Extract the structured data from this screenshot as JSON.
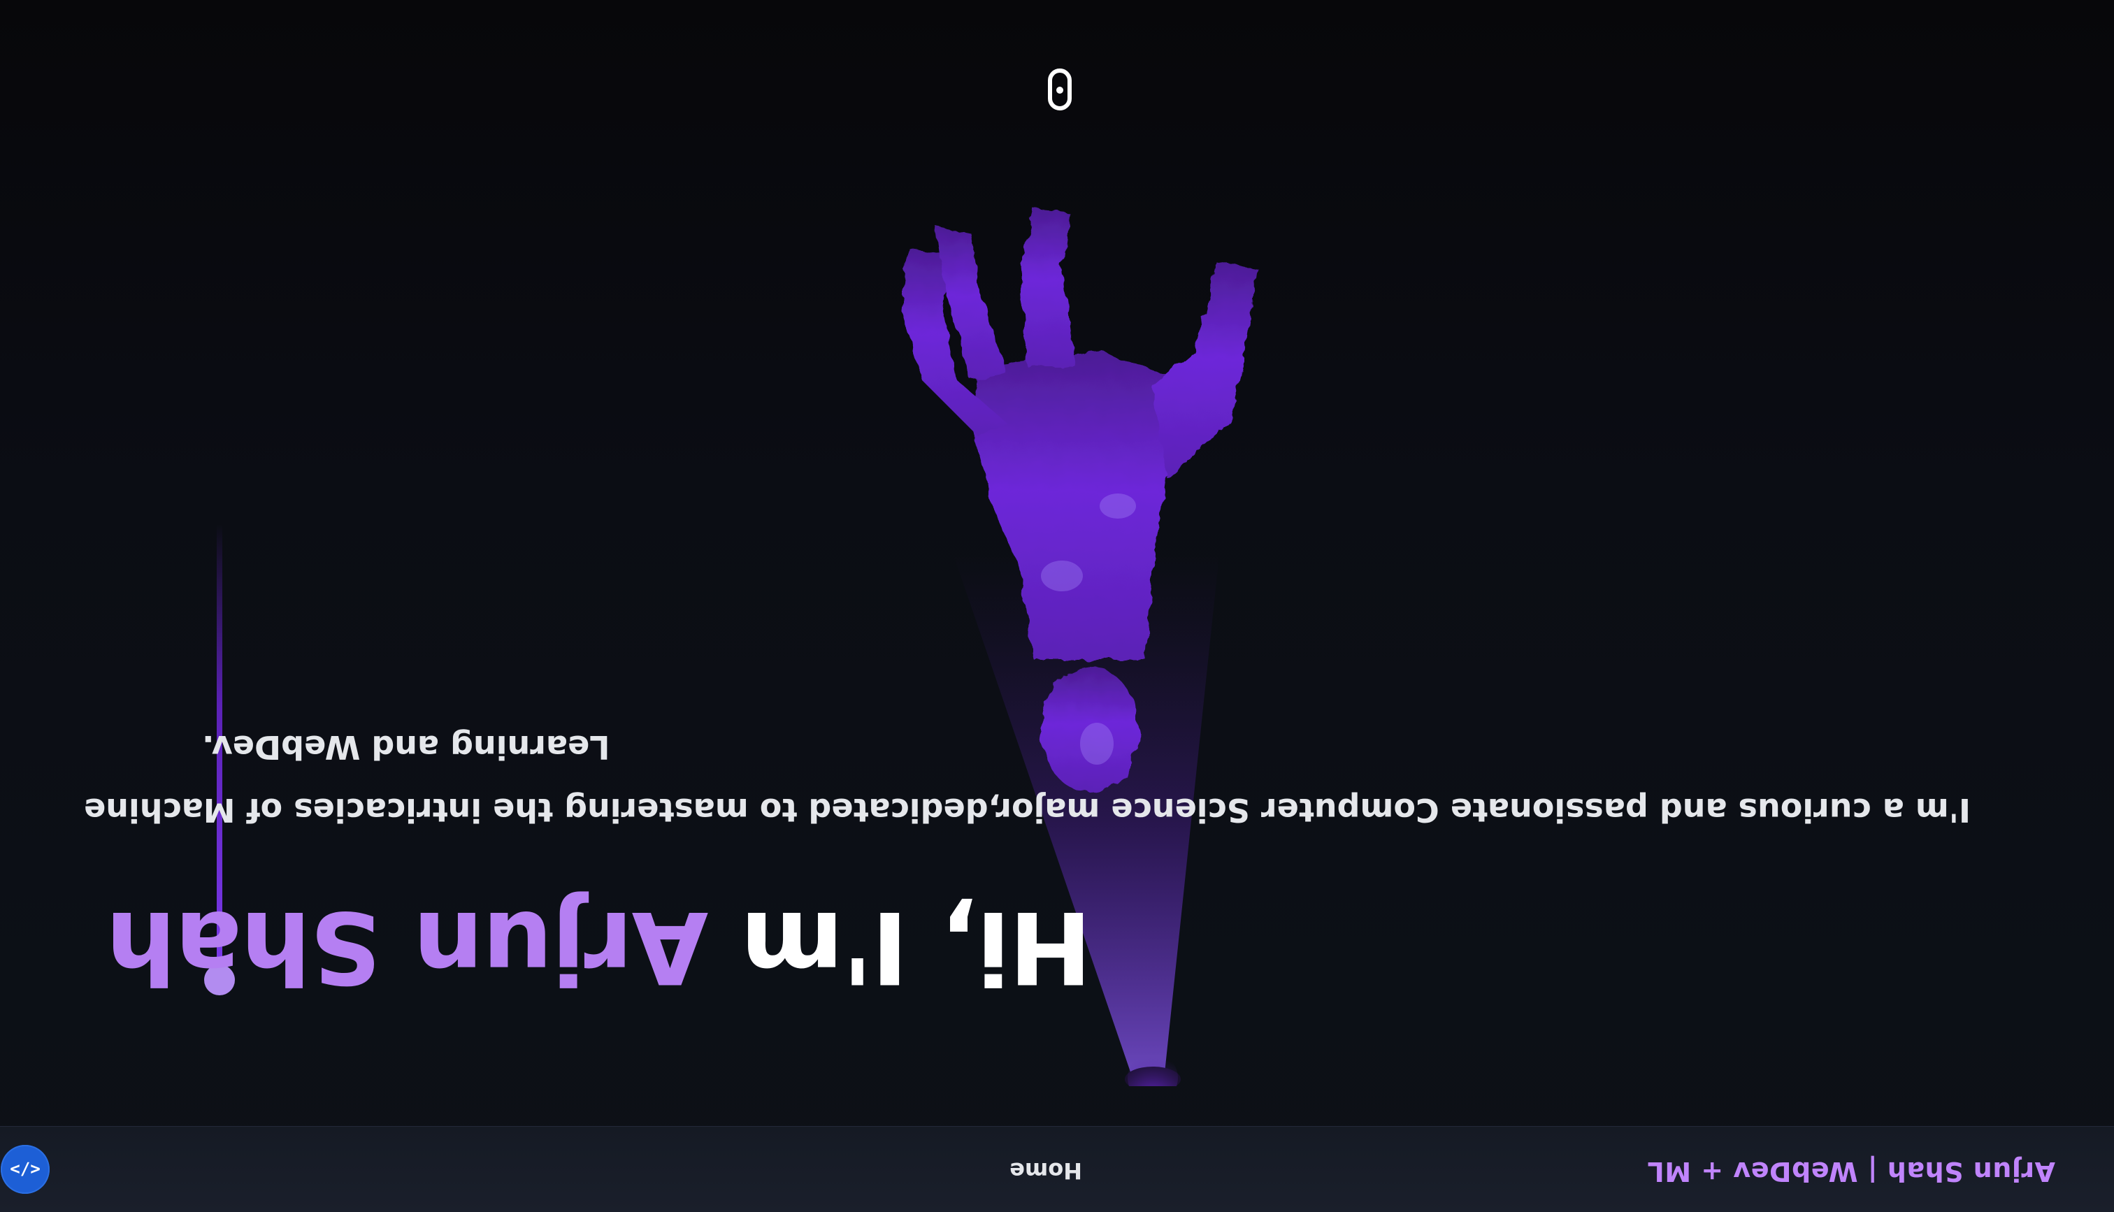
{
  "navbar": {
    "brand": "Arjun Shah | WebDev + ML",
    "links": [
      {
        "label": "Home"
      }
    ],
    "code_button_label": "</>"
  },
  "hero": {
    "greeting": "Hi, I'm ",
    "name": "Arjun Shah",
    "intro_line_1": "I'm a curious and passionate Computer Science major,dedicated to mastering the intricacies of Machine",
    "intro_line_2": "Learning and WebDev."
  },
  "icons": {
    "code": "code-brackets-icon",
    "scroll": "mouse-scroll-icon",
    "statue": "statue-figure"
  },
  "colors": {
    "accent": "#b57ff2",
    "brand_text": "#c084fc",
    "statue": "#6d28d9",
    "button": "#1d5fd6",
    "background": "#0b0d14"
  }
}
